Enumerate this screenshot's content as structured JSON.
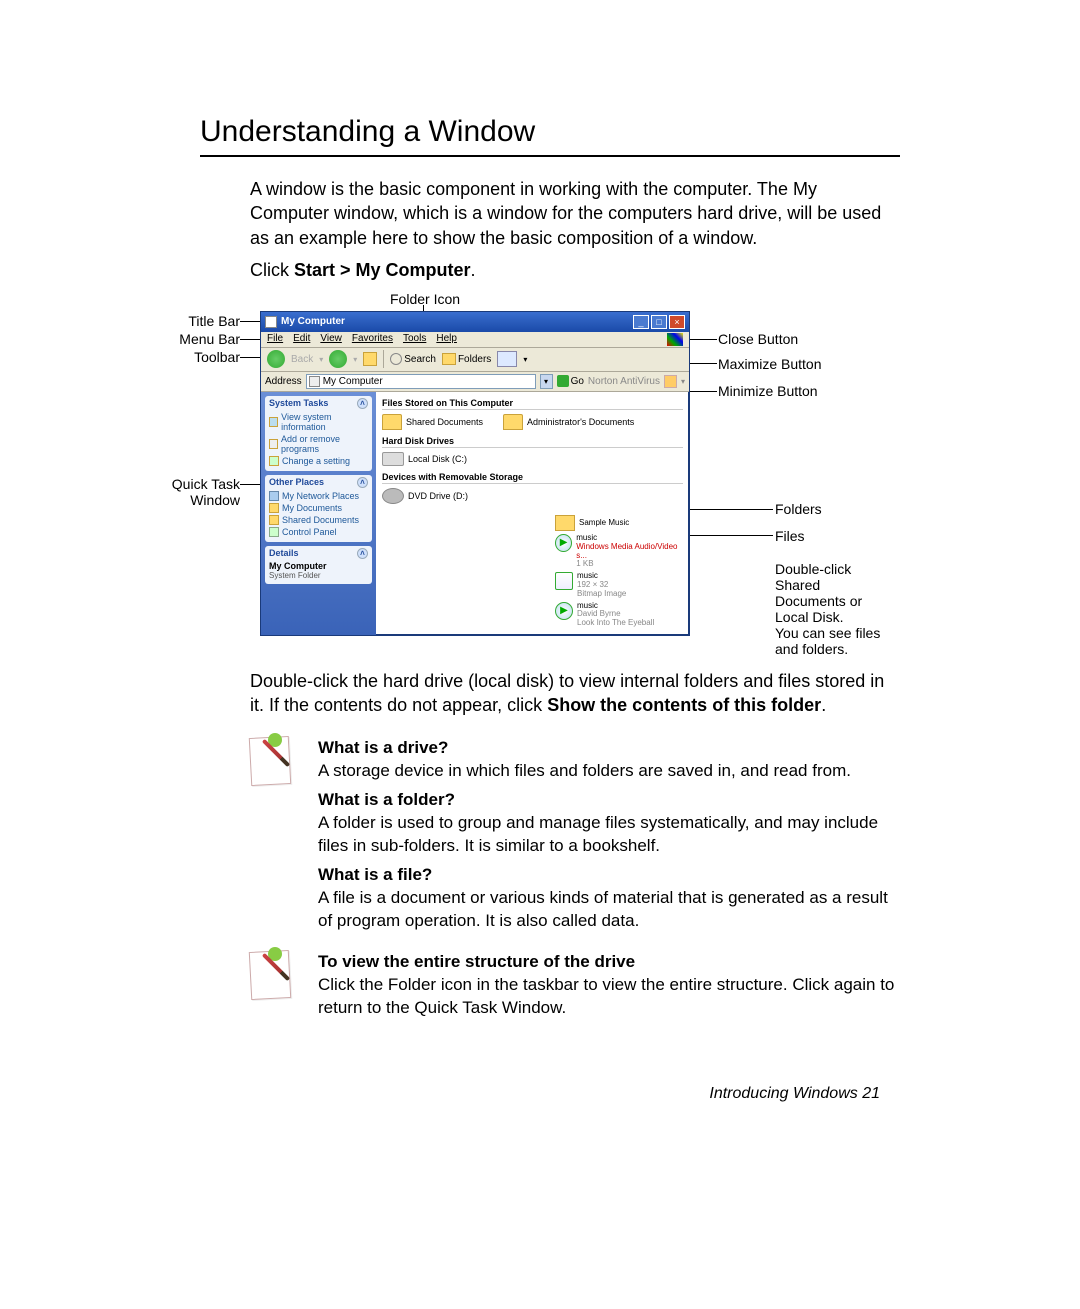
{
  "title": "Understanding a Window",
  "intro": "A window is the basic component in working with the computer. The My Computer window, which is a window for the computers hard drive, will be used as an example here to show the basic composition of a window.",
  "click_prefix": "Click ",
  "click_bold": "Start > My Computer",
  "click_suffix": ".",
  "labels": {
    "folder_icon": "Folder Icon",
    "title_bar": "Title Bar",
    "menu_bar": "Menu Bar",
    "toolbar": "Toolbar",
    "quick_task_window_l1": "Quick Task",
    "quick_task_window_l2": "Window",
    "close_button": "Close Button",
    "maximize_button": "Maximize Button",
    "minimize_button": "Minimize Button",
    "folders": "Folders",
    "files": "Files",
    "dbl_l1": "Double-click",
    "dbl_l2": "Shared",
    "dbl_l3": "Documents or",
    "dbl_l4": "Local Disk.",
    "dbl_l5": "You can see files",
    "dbl_l6": "and folders."
  },
  "window": {
    "title": "My Computer",
    "menus": {
      "file": "File",
      "edit": "Edit",
      "view": "View",
      "favorites": "Favorites",
      "tools": "Tools",
      "help": "Help"
    },
    "toolbar": {
      "back": "Back",
      "search": "Search",
      "folders": "Folders"
    },
    "address_label": "Address",
    "address_value": "My Computer",
    "go": "Go",
    "norton": "Norton AntiVirus",
    "side": {
      "system_tasks": "System Tasks",
      "view_sys": "View system information",
      "add_remove": "Add or remove programs",
      "change_setting": "Change a setting",
      "other_places": "Other Places",
      "net_places": "My Network Places",
      "my_docs": "My Documents",
      "shared_docs": "Shared Documents",
      "ctrl_panel": "Control Panel",
      "details": "Details",
      "details_title": "My Computer",
      "details_sub": "System Folder"
    },
    "content": {
      "s1": "Files Stored on This Computer",
      "shared_documents": "Shared Documents",
      "admin_docs": "Administrator's Documents",
      "s2": "Hard Disk Drives",
      "local_disk": "Local Disk (C:)",
      "s3": "Devices with Removable Storage",
      "dvd": "DVD Drive (D:)"
    },
    "preview": {
      "folder": "Sample Music",
      "f1_name": "music",
      "f1_meta1": "Windows Media Audio/Video s...",
      "f1_meta2": "1 KB",
      "f2_name": "music",
      "f2_meta1": "192 × 32",
      "f2_meta2": "Bitmap Image",
      "f3_name": "music",
      "f3_meta1": "David Byrne",
      "f3_meta2": "Look Into The Eyeball"
    }
  },
  "para2_a": "Double-click the hard drive (local disk) to view internal folders and files stored in it. If the contents do not appear, click ",
  "para2_b": "Show the contents of this folder",
  "para2_c": ".",
  "note1": {
    "h1": "What is a drive?",
    "p1": "A storage device in which files and folders are saved in, and read from.",
    "h2": "What is a folder?",
    "p2": "A folder is used to group and manage files systematically, and may include files in sub-folders. It is similar to a bookshelf.",
    "h3": "What is a file?",
    "p3": "A file is a document or various kinds of material that is generated as a result of program operation. It is also called data."
  },
  "note2": {
    "h": "To view the entire structure of the drive",
    "p": "Click the Folder icon in the taskbar to view the entire structure. Click again to return to the Quick Task Window."
  },
  "footer": "Introducing Windows  21"
}
